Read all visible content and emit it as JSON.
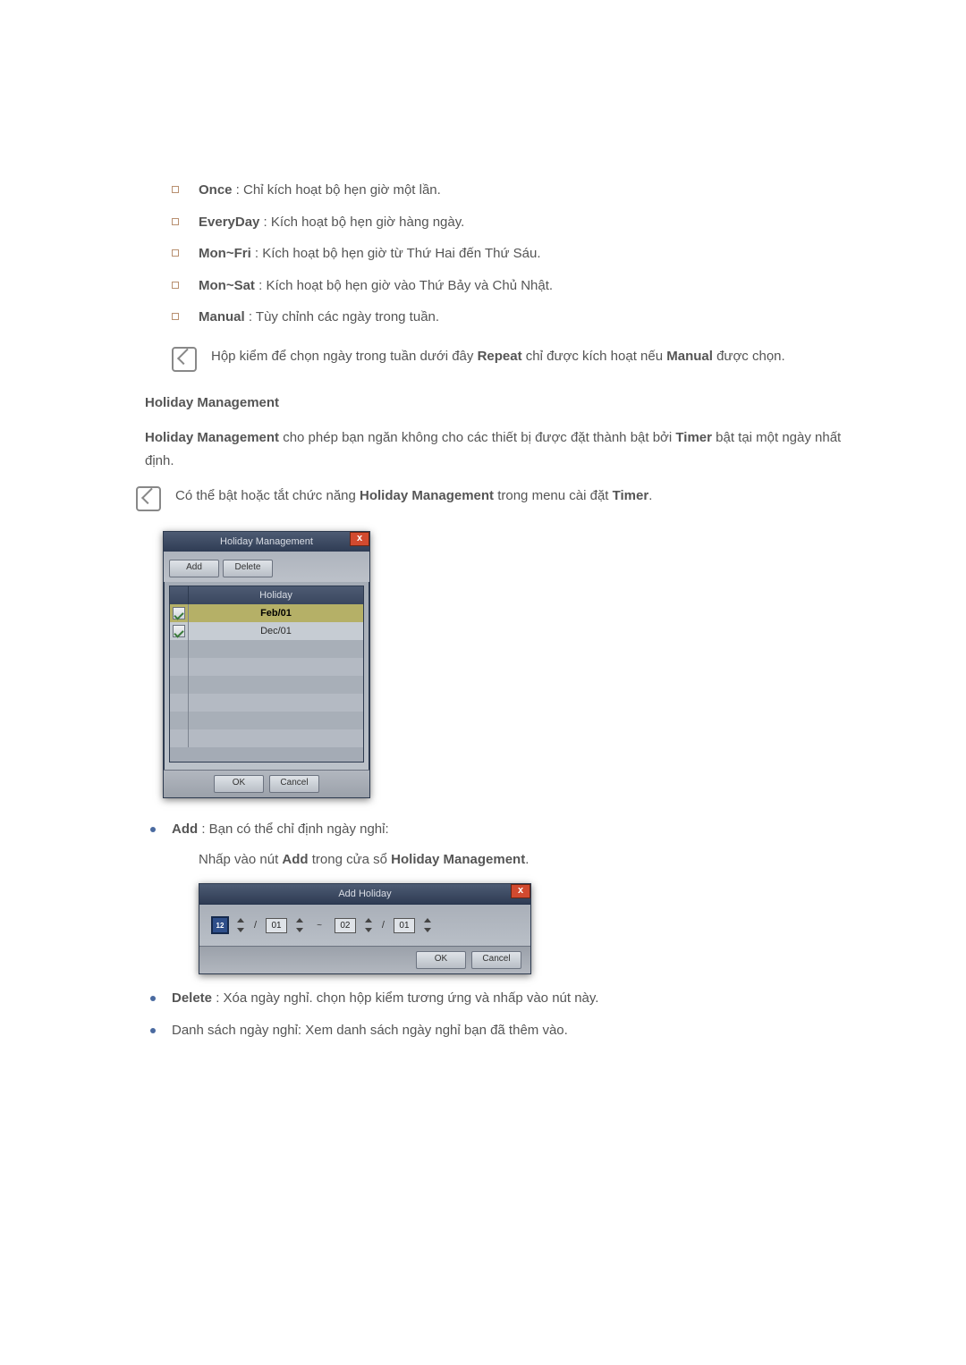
{
  "options": [
    {
      "label": "Once",
      "desc": " : Chỉ kích hoạt bộ hẹn giờ một lần."
    },
    {
      "label": "EveryDay",
      "desc": " : Kích hoạt bộ hẹn giờ hàng ngày."
    },
    {
      "label": "Mon~Fri",
      "desc": " : Kích hoạt bộ hẹn giờ từ Thứ Hai đến Thứ Sáu."
    },
    {
      "label": "Mon~Sat",
      "desc": " : Kích hoạt bộ hẹn giờ vào Thứ Bảy và Chủ Nhật."
    },
    {
      "label": "Manual",
      "desc": " : Tùy chỉnh các ngày trong tuần."
    }
  ],
  "note1": {
    "pre": "Hộp kiểm để chọn ngày trong tuần dưới đây ",
    "b1": "Repeat",
    "mid": " chỉ được kích hoạt nếu ",
    "b2": "Manual",
    "post": " được chọn."
  },
  "hm_section_title": "Holiday Management",
  "hm_para": {
    "b1": "Holiday Management",
    "t1": " cho phép bạn ngăn không cho các thiết bị được đặt thành bật bởi ",
    "b2": "Timer",
    "t2": " bật tại một ngày nhất định."
  },
  "note2": {
    "t1": "Có thể bật hoặc tắt chức năng ",
    "b1": "Holiday Management",
    "t2": " trong menu cài đặt ",
    "b2": "Timer",
    "t3": "."
  },
  "hm_dialog": {
    "title": "Holiday Management",
    "close": "x",
    "add": "Add",
    "delete": "Delete",
    "col_header": "Holiday",
    "rows": [
      {
        "checked": true,
        "value": "Feb/01"
      },
      {
        "checked": true,
        "value": "Dec/01"
      }
    ],
    "ok": "OK",
    "cancel": "Cancel"
  },
  "bullets": {
    "add": {
      "b": "Add",
      "desc": " : Bạn có thể chỉ định ngày nghỉ:",
      "line2_pre": "Nhấp vào nút ",
      "line2_b1": "Add",
      "line2_mid": " trong cửa sổ ",
      "line2_b2": "Holiday Management",
      "line2_post": "."
    },
    "delete": {
      "b": "Delete",
      "desc": " : Xóa ngày nghỉ. chọn hộp kiểm tương ứng và nhấp vào nút này."
    },
    "list": "Danh sách ngày nghỉ: Xem danh sách ngày nghỉ bạn đã thêm vào."
  },
  "ah_dialog": {
    "title": "Add Holiday",
    "close": "x",
    "m1": "01",
    "d1": "02",
    "m2": "01",
    "tilde": "~",
    "slash": "/",
    "ok": "OK",
    "cancel": "Cancel"
  }
}
